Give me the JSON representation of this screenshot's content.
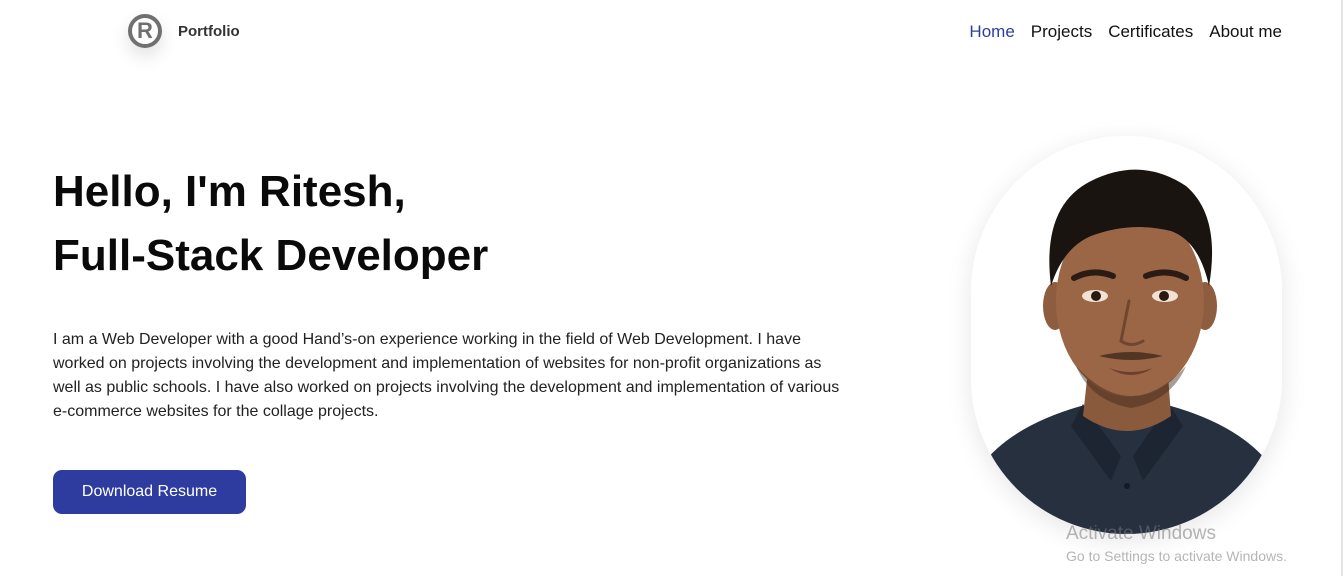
{
  "header": {
    "logo_glyph": "R",
    "logo_text": "Portfolio",
    "nav": [
      {
        "label": "Home",
        "active": true
      },
      {
        "label": "Projects",
        "active": false
      },
      {
        "label": "Certificates",
        "active": false
      },
      {
        "label": "About me",
        "active": false
      }
    ]
  },
  "hero": {
    "title_line1": "Hello, I'm Ritesh,",
    "title_line2": "Full-Stack Developer",
    "description": "I am a Web Developer with a good Hand’s-on experience working in the field of Web Development. I have worked on projects involving the development and implementation of websites for non-profit organizations as well as public schools. I have also worked on projects involving the development and implementation of various e-commerce websites for the collage projects.",
    "download_button": "Download Resume"
  },
  "windows_watermark": {
    "title": "Activate Windows",
    "subtitle": "Go to Settings to activate Windows."
  },
  "colors": {
    "accent": "#2f3c9f",
    "nav_active": "#2e3e9c",
    "text": "#111111",
    "background": "#ffffff"
  },
  "icons": {
    "logo": "registered-r-circle-icon"
  }
}
